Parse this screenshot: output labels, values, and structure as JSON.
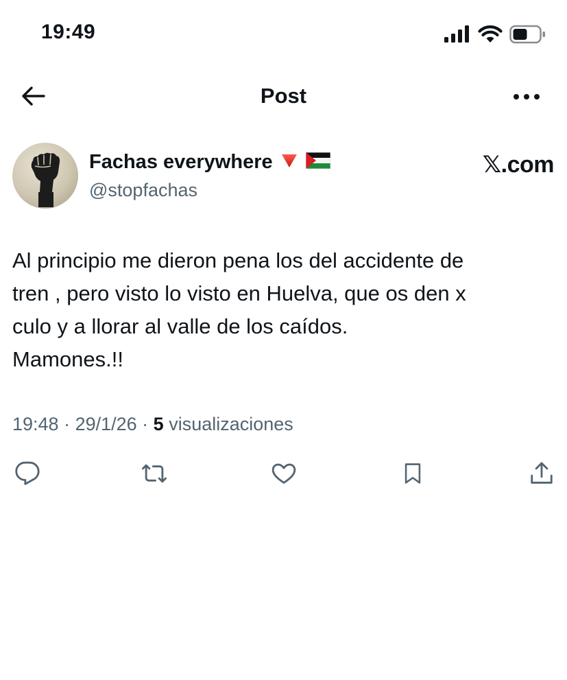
{
  "status_bar": {
    "time": "19:49",
    "icons": [
      "signal-icon",
      "wifi-icon",
      "battery-icon"
    ]
  },
  "header": {
    "title": "Post",
    "back_icon": "arrow-left-icon",
    "more_icon": "more-horizontal-icon"
  },
  "author": {
    "name": "Fachas everywhere",
    "name_emojis": [
      "🔻",
      "🇵🇸"
    ],
    "handle": "@stopfachas",
    "avatar_icon": "raised-fist-avatar"
  },
  "brand": {
    "x_glyph": "𝕏",
    "suffix": ".com"
  },
  "post": {
    "text": "Al principio me dieron pena los del accidente de\ntren , pero visto lo visto en Huelva, que os den x\nculo y a llorar al valle de los caídos.\nMamones.!!"
  },
  "meta": {
    "time": "19:48",
    "sep1": " · ",
    "date": "29/1/26",
    "sep2": " · ",
    "views_count": "5",
    "views_label": " visualizaciones"
  },
  "actions": [
    "reply-icon",
    "repost-icon",
    "like-icon",
    "bookmark-icon",
    "share-icon"
  ],
  "colors": {
    "text": "#0f1419",
    "secondary": "#536471",
    "background": "#ffffff"
  }
}
